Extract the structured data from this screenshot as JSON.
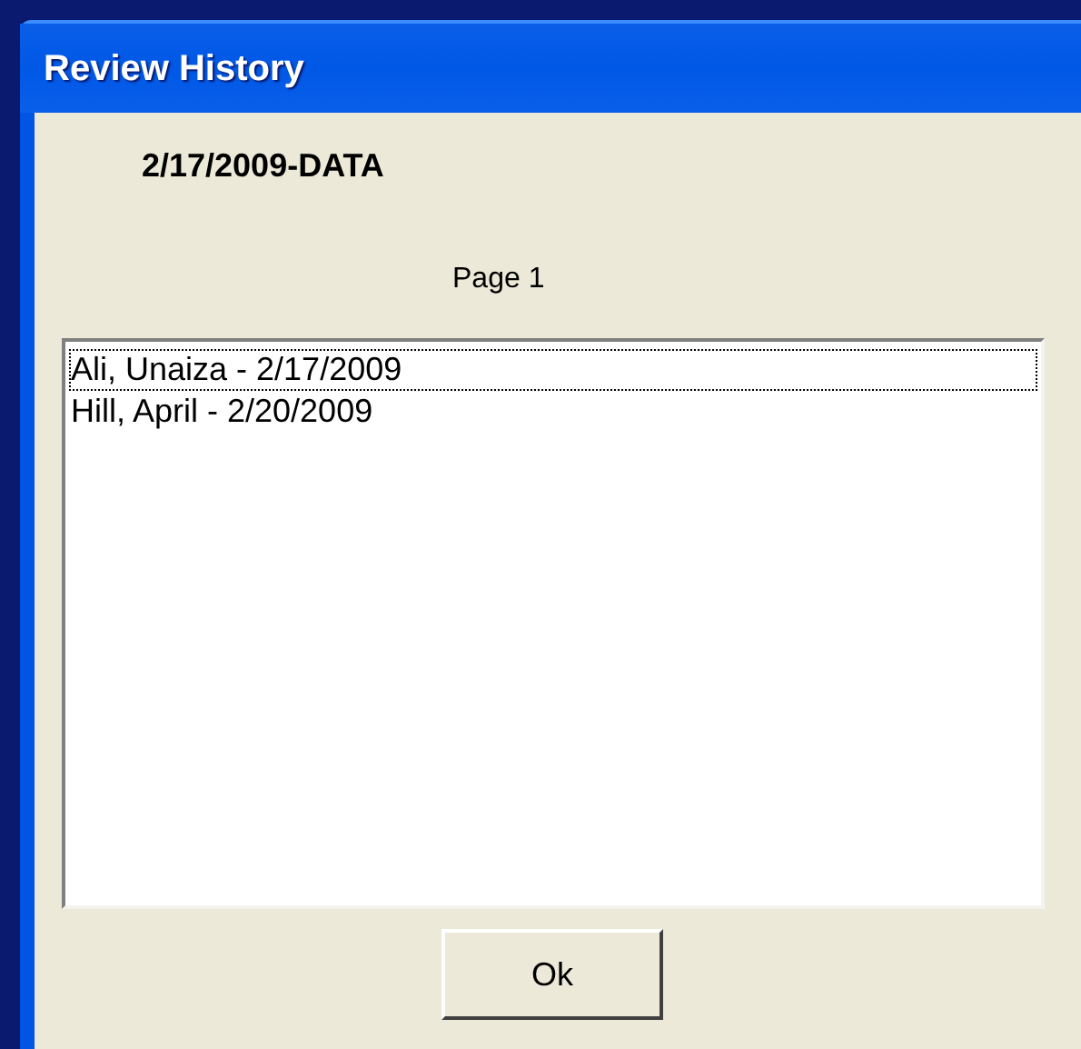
{
  "window": {
    "title": "Review History"
  },
  "heading": "2/17/2009-DATA",
  "page_label": "Page 1",
  "list": {
    "items": [
      {
        "label": "Ali, Unaiza - 2/17/2009",
        "selected": true
      },
      {
        "label": "Hill, April - 2/20/2009",
        "selected": false
      }
    ]
  },
  "buttons": [
    "Ok"
  ]
}
